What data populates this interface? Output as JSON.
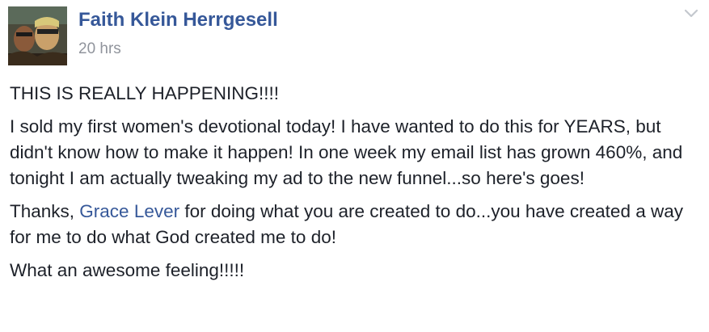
{
  "post": {
    "author": "Faith Klein Herrgesell",
    "timestamp": "20 hrs",
    "paragraphs": {
      "p1": "THIS IS REALLY HAPPENING!!!!",
      "p2": "I sold my first women's devotional today! I have wanted to do this for YEARS, but didn't know how to make it happen! In one week my email list has grown 460%, and tonight I am actually tweaking my ad to the new funnel...so here's goes!",
      "p3_before": "Thanks, ",
      "p3_mention": "Grace Lever",
      "p3_after": " for doing what you are created to do...you have created a way for me to do what God created me to do!",
      "p4": "What an awesome feeling!!!!!"
    }
  },
  "icons": {
    "options": "chevron-down-icon",
    "avatar": "profile-photo"
  },
  "colors": {
    "link": "#365899",
    "text": "#1d2129",
    "meta": "#90949c",
    "chevron": "#c4c8ce"
  }
}
